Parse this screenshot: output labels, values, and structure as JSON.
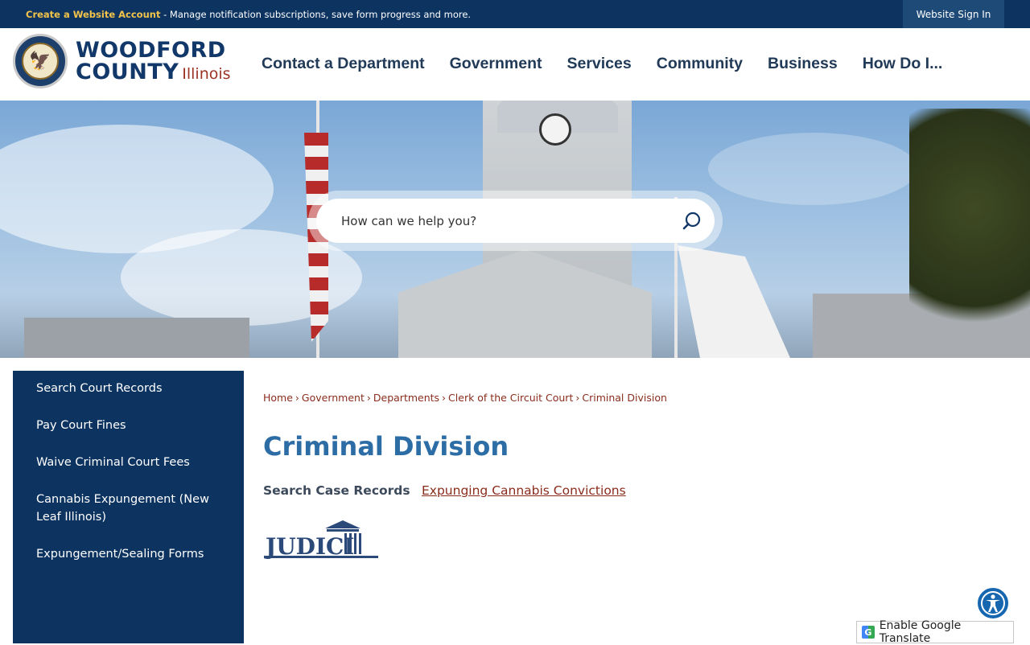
{
  "topbar": {
    "account_link": "Create a Website Account",
    "account_message": " - Manage notification subscriptions, save form progress and more.",
    "sign_in": "Website Sign In"
  },
  "header": {
    "logo_line1": "WOODFORD",
    "logo_line2": "COUNTY",
    "logo_state": "Illinois",
    "nav": [
      "Contact a Department",
      "Government",
      "Services",
      "Community",
      "Business",
      "How Do I..."
    ]
  },
  "hero": {
    "search_placeholder": "How can we help you?"
  },
  "sidebar": {
    "items": [
      "Search Court Records",
      "Pay Court Fines",
      "Waive Criminal Court Fees",
      "Cannabis Expungement (New Leaf Illinois)",
      "Expungement/Sealing Forms"
    ]
  },
  "breadcrumb": [
    "Home",
    "Government",
    "Departments",
    "Clerk of the Circuit Court",
    "Criminal Division"
  ],
  "main": {
    "title": "Criminal Division",
    "search_label": "Search Case Records",
    "cannabis_link": "Expunging Cannabis Convictions",
    "judici_logo_text": "JUDICI"
  },
  "footer_widgets": {
    "translate_label": "Enable Google Translate"
  },
  "colors": {
    "navy": "#0d3461",
    "title_blue": "#2d6da6",
    "link_red": "#8a2c1c",
    "accent_gold": "#f3c34a"
  }
}
